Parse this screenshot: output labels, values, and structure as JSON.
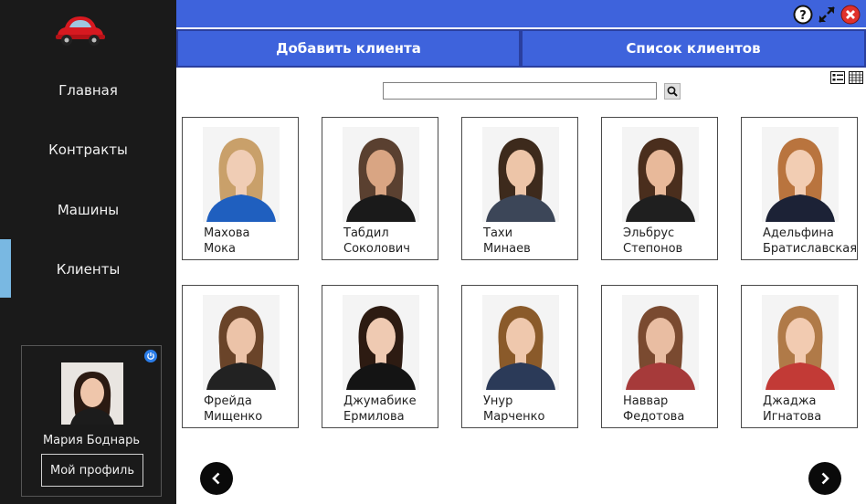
{
  "sidebar": {
    "logo_icon": "red-car-icon",
    "items": [
      {
        "label": "Главная"
      },
      {
        "label": "Контракты"
      },
      {
        "label": "Машины"
      },
      {
        "label": "Клиенты",
        "active": true
      }
    ],
    "user": {
      "name": "Мария Боднарь",
      "profile_label": "Мой профиль"
    }
  },
  "titlebar": {
    "help_icon": "help-icon",
    "maximize_icon": "expand-icon",
    "close_icon": "close-icon"
  },
  "tabs": [
    {
      "label": "Добавить клиента"
    },
    {
      "label": "Список клиентов"
    }
  ],
  "search": {
    "value": "",
    "placeholder": ""
  },
  "clients": [
    {
      "first": "Махова",
      "last": "Мока",
      "hair": "#c9a06a",
      "skin": "#f0cdb5",
      "shirt": "#1f5fbf",
      "bg": "#f4f4f4"
    },
    {
      "first": "Табдил",
      "last": "Соколович",
      "hair": "#5a4030",
      "skin": "#d9a583",
      "shirt": "#1a1a1a",
      "bg": "#f4f4f4"
    },
    {
      "first": "Тахи",
      "last": "Минаев",
      "hair": "#3d2a1c",
      "skin": "#edc5a8",
      "shirt": "#3c4658",
      "bg": "#f4f4f4"
    },
    {
      "first": "Эльбрус",
      "last": "Степонов",
      "hair": "#4a2e1d",
      "skin": "#e8b99a",
      "shirt": "#1f1f1f",
      "bg": "#f4f4f4"
    },
    {
      "first": "Адельфина",
      "last": "Братиславская",
      "hair": "#b9743e",
      "skin": "#f2cdb3",
      "shirt": "#1c2236",
      "bg": "#f4f4f4"
    },
    {
      "first": "Фрейда",
      "last": "Мищенко",
      "hair": "#6a4429",
      "skin": "#ecc3a8",
      "shirt": "#222222",
      "bg": "#f4f4f4"
    },
    {
      "first": "Джумабике",
      "last": "Ермилова",
      "hair": "#2d1b12",
      "skin": "#efcab2",
      "shirt": "#141414",
      "bg": "#f4f4f4"
    },
    {
      "first": "Унур",
      "last": "Марченко",
      "hair": "#8a5a2a",
      "skin": "#efc8ad",
      "shirt": "#2b3a58",
      "bg": "#f4f4f4"
    },
    {
      "first": "Наввар",
      "last": "Федотова",
      "hair": "#7a4a30",
      "skin": "#e9bda2",
      "shirt": "#a63a3a",
      "bg": "#f4f4f4"
    },
    {
      "first": "Джаджа",
      "last": "Игнатова",
      "hair": "#b07a48",
      "skin": "#f2cbb1",
      "shirt": "#c23a36",
      "bg": "#f4f4f4"
    }
  ],
  "pager": {
    "prev_icon": "chevron-left-icon",
    "next_icon": "chevron-right-icon"
  },
  "colors": {
    "accent": "#3e63dc",
    "sidebar_bg": "#1a1a1a",
    "active_marker": "#79b8e2",
    "close_red": "#e0312b",
    "power_blue": "#2b7de9"
  }
}
